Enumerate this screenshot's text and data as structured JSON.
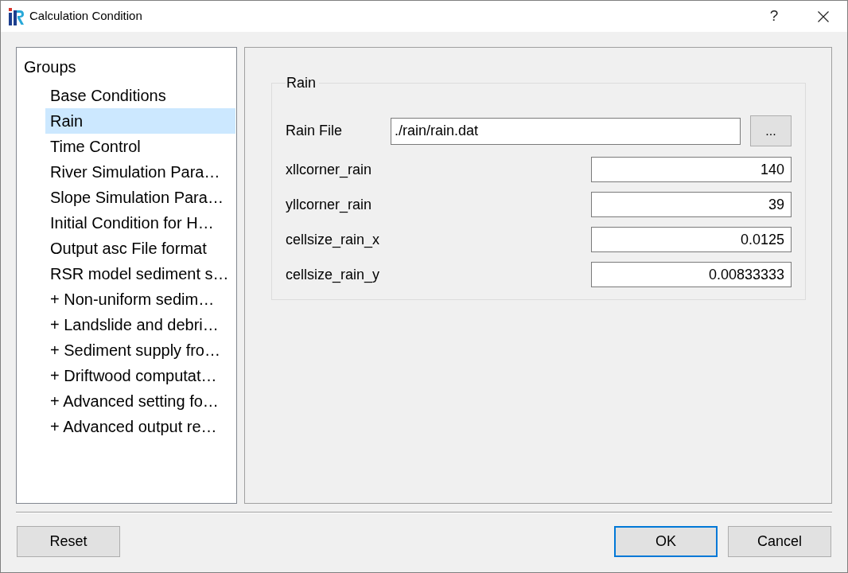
{
  "window": {
    "title": "Calculation Condition",
    "help_button": "?"
  },
  "groups_tree": {
    "label": "Groups",
    "children": [
      {
        "label": "Base Conditions",
        "selected": false
      },
      {
        "label": "Rain",
        "selected": true
      },
      {
        "label": "Time Control",
        "selected": false
      },
      {
        "label": "River Simulation Para…",
        "selected": false
      },
      {
        "label": "Slope Simulation Para…",
        "selected": false
      },
      {
        "label": "Initial Condition for H…",
        "selected": false
      },
      {
        "label": "Output asc File format",
        "selected": false
      },
      {
        "label": "RSR model sediment s…",
        "selected": false
      },
      {
        "label": "+ Non-uniform sedim…",
        "selected": false
      },
      {
        "label": "+ Landslide and debri…",
        "selected": false
      },
      {
        "label": "+ Sediment supply fro…",
        "selected": false
      },
      {
        "label": "+ Driftwood computat…",
        "selected": false
      },
      {
        "label": "+ Advanced setting fo…",
        "selected": false
      },
      {
        "label": "+ Advanced output re…",
        "selected": false
      }
    ]
  },
  "settings": {
    "group_title": "Rain",
    "fields": [
      {
        "kind": "file",
        "label": "Rain File",
        "value": "./rain/rain.dat",
        "browse_button": "..."
      },
      {
        "kind": "number",
        "label": "xllcorner_rain",
        "value": "140"
      },
      {
        "kind": "number",
        "label": "yllcorner_rain",
        "value": "39"
      },
      {
        "kind": "number",
        "label": "cellsize_rain_x",
        "value": "0.0125"
      },
      {
        "kind": "number",
        "label": "cellsize_rain_y",
        "value": "0.00833333"
      }
    ]
  },
  "footer": {
    "reset_button": "Reset",
    "buttons": [
      {
        "label": "OK",
        "default": true
      },
      {
        "label": "Cancel",
        "default": false
      }
    ]
  }
}
